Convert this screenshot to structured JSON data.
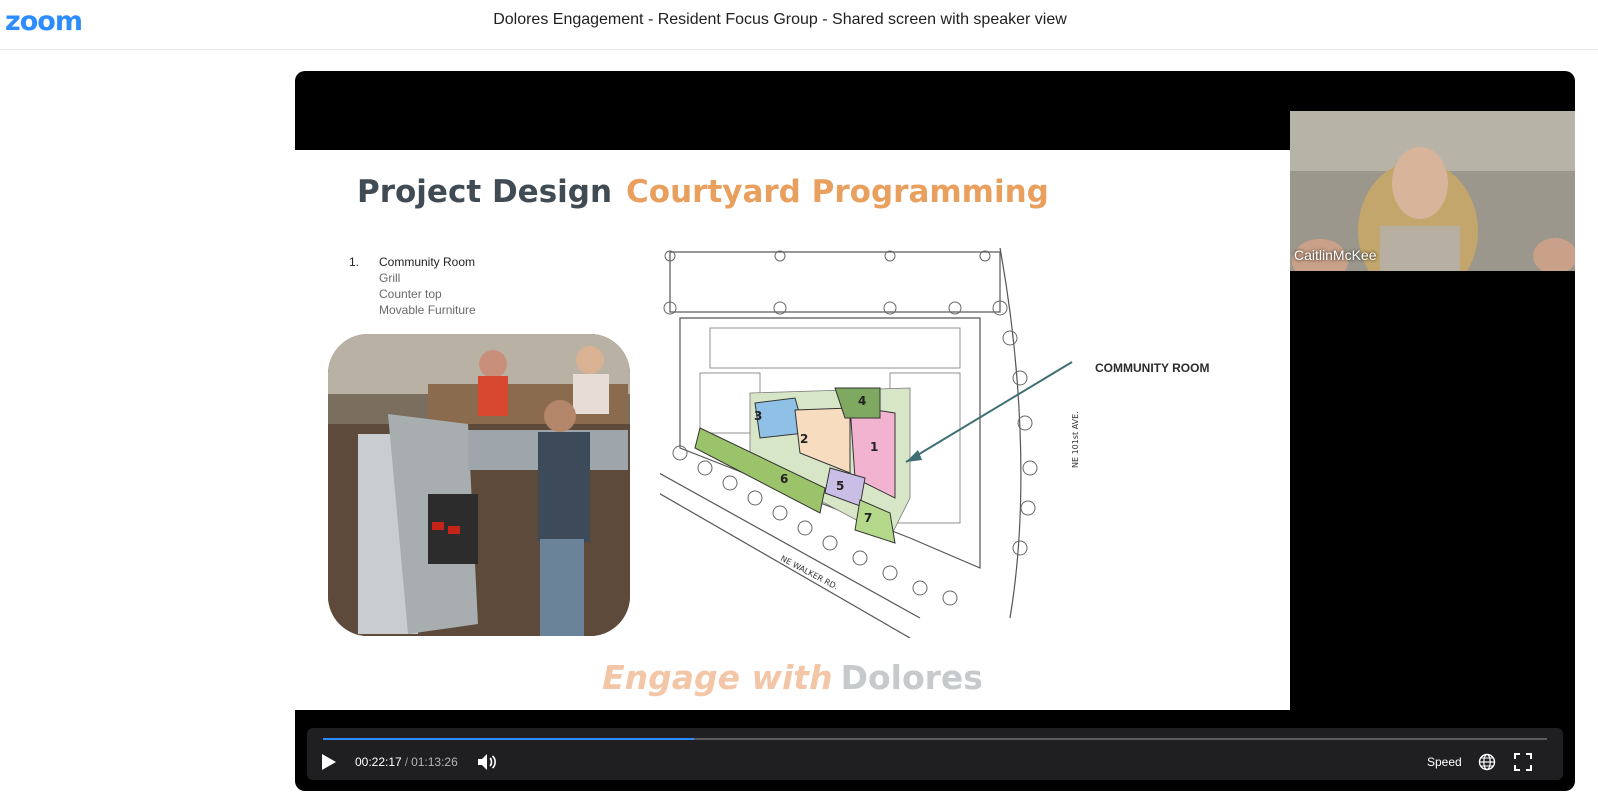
{
  "app": {
    "logo": "zoom",
    "title": "Dolores Engagement - Resident Focus Group - Shared screen with speaker view"
  },
  "slide": {
    "title_part1": "Project Design",
    "title_part2": "Courtyard Programming",
    "list_number": "1.",
    "list_items": [
      "Community Room",
      "Grill",
      "Counter top",
      "Movable Furniture"
    ],
    "plan_callout": "COMMUNITY ROOM",
    "street_label_1": "NE WALKER RD.",
    "street_label_2": "NE 101st AVE.",
    "zone_numbers": [
      "1",
      "2",
      "3",
      "4",
      "5",
      "6",
      "7"
    ],
    "branding_part1": "Engage with",
    "branding_part2": "Dolores"
  },
  "speaker": {
    "name": "CaitlinMcKee"
  },
  "player": {
    "current_time": "00:22:17",
    "separator": "/",
    "duration": "01:13:26",
    "progress_fraction": 0.3035,
    "speed_label": "Speed",
    "icons": [
      "play-icon",
      "volume-icon",
      "globe-icon",
      "fullscreen-icon"
    ]
  },
  "colors": {
    "zoom_blue": "#2d8cff",
    "title_dark": "#404b54",
    "title_orange": "#e9a05f",
    "callout_arrow": "#3f6e75"
  }
}
